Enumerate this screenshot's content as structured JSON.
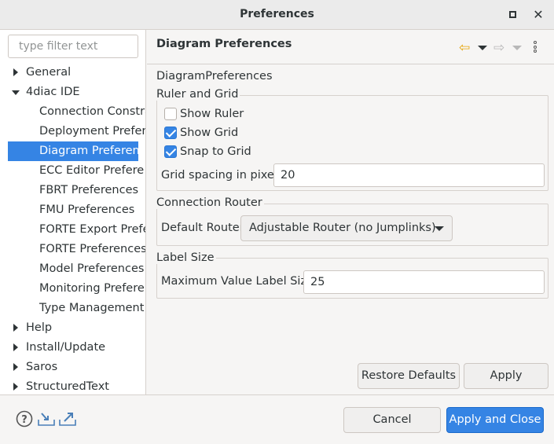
{
  "window": {
    "title": "Preferences"
  },
  "filter": {
    "placeholder": "type filter text"
  },
  "tree": [
    {
      "label": "General",
      "expander": "collapsed",
      "level": 0
    },
    {
      "label": "4diac IDE",
      "expander": "expanded",
      "level": 0
    },
    {
      "label": "Connection Constra",
      "expander": "none",
      "level": 1
    },
    {
      "label": "Deployment Prefere",
      "expander": "none",
      "level": 1
    },
    {
      "label": "Diagram Preferenc",
      "expander": "none",
      "level": 1,
      "selected": true
    },
    {
      "label": "ECC Editor Prefere",
      "expander": "none",
      "level": 1
    },
    {
      "label": "FBRT Preferences",
      "expander": "none",
      "level": 1
    },
    {
      "label": "FMU Preferences",
      "expander": "none",
      "level": 1
    },
    {
      "label": "FORTE Export Prefe",
      "expander": "none",
      "level": 1
    },
    {
      "label": "FORTE Preferences",
      "expander": "none",
      "level": 1
    },
    {
      "label": "Model Preferences",
      "expander": "none",
      "level": 1
    },
    {
      "label": "Monitoring Prefere",
      "expander": "none",
      "level": 1
    },
    {
      "label": "Type Management",
      "expander": "none",
      "level": 1
    },
    {
      "label": "Help",
      "expander": "collapsed",
      "level": 0
    },
    {
      "label": "Install/Update",
      "expander": "collapsed",
      "level": 0
    },
    {
      "label": "Saros",
      "expander": "collapsed",
      "level": 0
    },
    {
      "label": "StructuredText",
      "expander": "collapsed",
      "level": 0
    }
  ],
  "page": {
    "title": "Diagram Preferences",
    "description": "DiagramPreferences",
    "ruler_group": {
      "label": "Ruler and Grid",
      "show_ruler": {
        "label": "Show Ruler",
        "checked": false
      },
      "show_grid": {
        "label": "Show Grid",
        "checked": true
      },
      "snap_to_grid": {
        "label": "Snap to Grid",
        "checked": true
      },
      "grid_spacing_label": "Grid spacing in pixels",
      "grid_spacing_value": "20"
    },
    "router_group": {
      "label": "Connection Router",
      "default_router_label": "Default Router",
      "default_router_value": "Adjustable Router (no Jumplinks)"
    },
    "label_group": {
      "label": "Label Size",
      "max_label_label": "Maximum Value Label Size",
      "max_label_value": "25"
    }
  },
  "buttons": {
    "restore_defaults": "Restore Defaults",
    "apply": "Apply",
    "cancel": "Cancel",
    "apply_and_close": "Apply and Close"
  },
  "colors": {
    "accent": "#3584e4",
    "nav_back": "#e5a50a"
  }
}
